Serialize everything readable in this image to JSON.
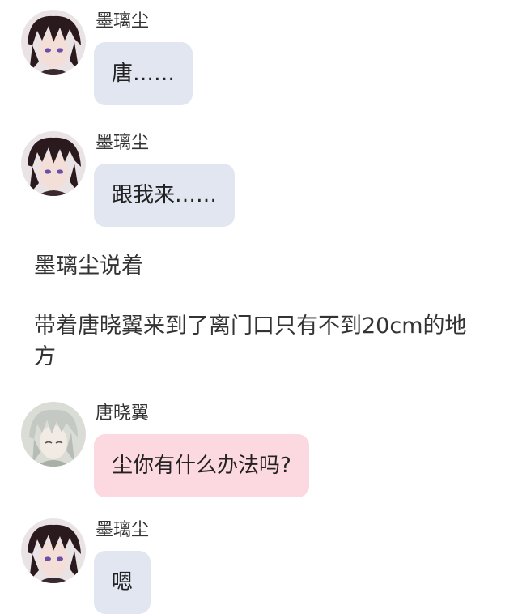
{
  "messages": [
    {
      "speaker": "墨璃尘",
      "text": "唐……",
      "avatar": "dark-hair-boy-avatar",
      "bubble_color": "#e1e6f1"
    },
    {
      "speaker": "墨璃尘",
      "text": "跟我来……",
      "avatar": "dark-hair-boy-avatar",
      "bubble_color": "#e1e6f1"
    },
    {
      "speaker": "唐晓翼",
      "text": "尘你有什么办法吗?",
      "avatar": "grey-hair-boy-avatar",
      "bubble_color": "#fcd8e0"
    },
    {
      "speaker": "墨璃尘",
      "text": "嗯",
      "avatar": "dark-hair-boy-avatar",
      "bubble_color": "#e1e6f1"
    }
  ],
  "narration": [
    "墨璃尘说着",
    "带着唐晓翼来到了离门口只有不到20cm的地方"
  ]
}
